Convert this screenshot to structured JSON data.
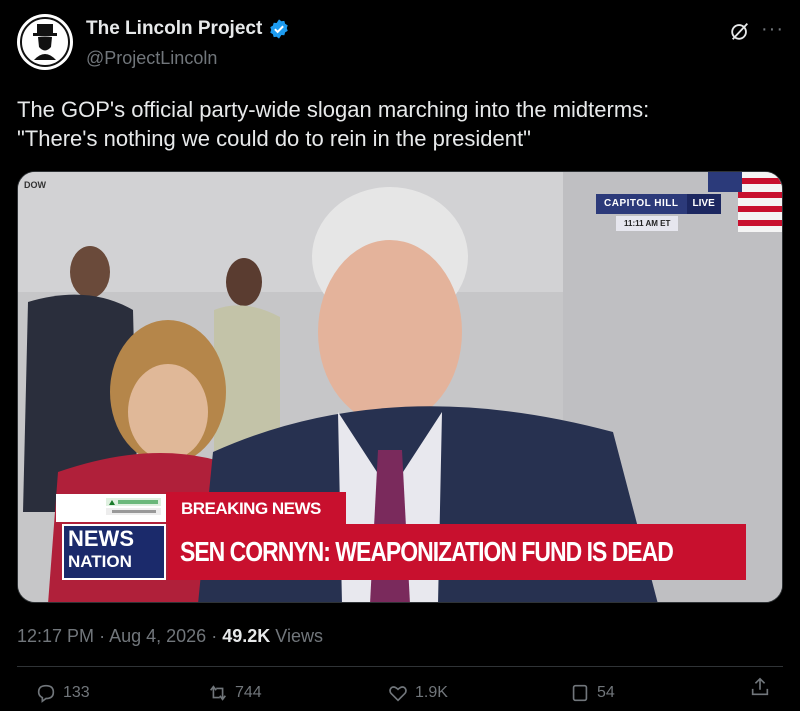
{
  "account": {
    "display_name": "The Lincoln Project",
    "handle": "@ProjectLincoln",
    "verified": true,
    "verified_color": "#1d9bf0"
  },
  "tweet": {
    "text": "The GOP's official party-wide slogan marching into the midterms:\n\"There's nothing we could do to rein in the president\""
  },
  "video": {
    "location_label": "CAPITOL HILL",
    "live_label": "LIVE",
    "time_label": "11:11 AM ET",
    "ticker_label": "DOW",
    "breaking_label": "BREAKING NEWS",
    "network_line1": "NEWS",
    "network_line2": "NATION",
    "headline": "SEN CORNYN: WEAPONIZATION FUND IS DEAD",
    "accent_red": "#c8102e",
    "network_blue": "#1b2a6b"
  },
  "meta": {
    "time": "12:17 PM",
    "separator": "·",
    "date": "Aug 4, 2026",
    "views_count": "49.2K",
    "views_label": "Views"
  },
  "actions": {
    "replies": "133",
    "reposts": "744",
    "likes": "1.9K",
    "bookmarks": "54"
  },
  "icons": [
    "grok-icon",
    "more-icon",
    "verified-badge-icon",
    "reply-icon",
    "repost-icon",
    "like-icon",
    "bookmark-icon",
    "share-icon"
  ]
}
